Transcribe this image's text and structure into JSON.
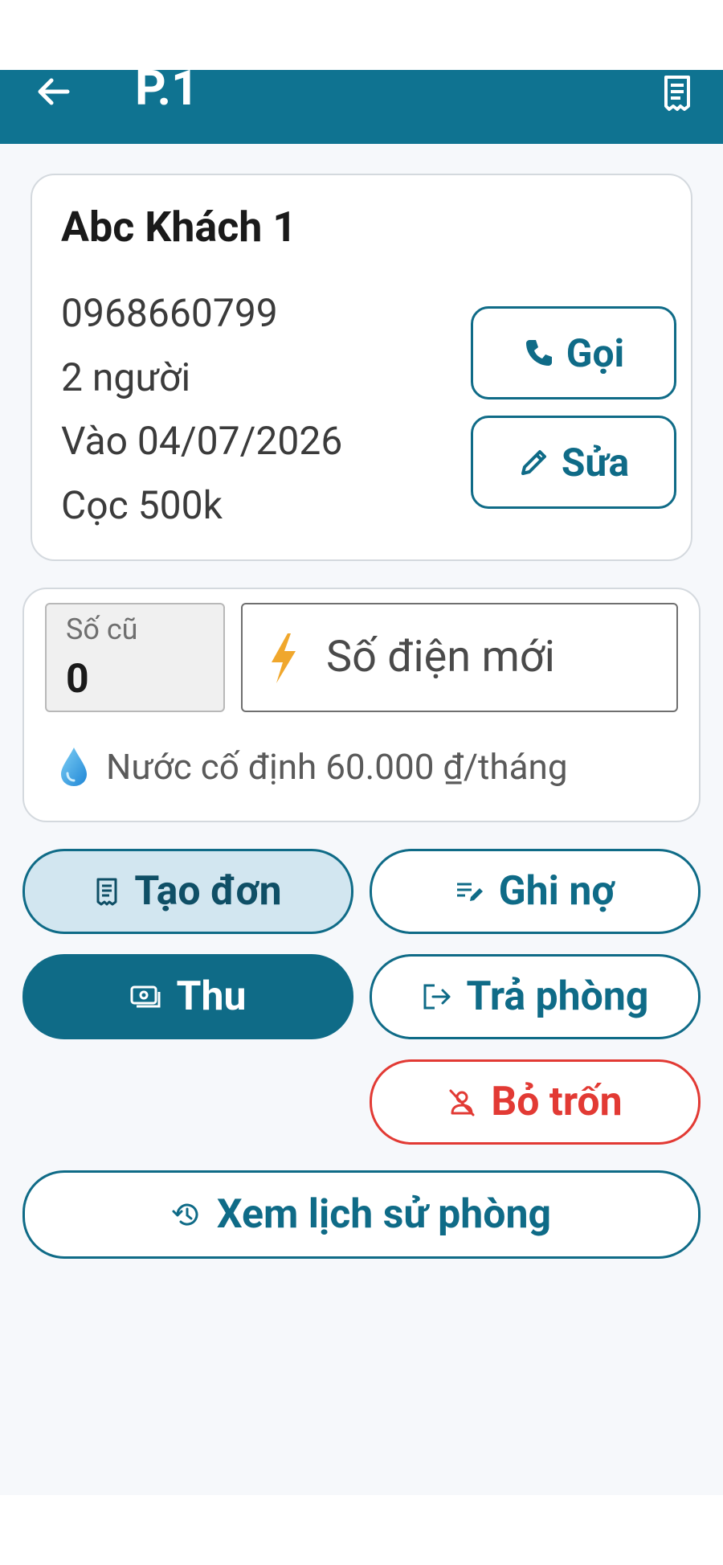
{
  "appbar": {
    "title": "P.1",
    "back_icon": "arrow-left-icon",
    "receipt_icon": "receipt-icon"
  },
  "tenant": {
    "name": "Abc Khách 1",
    "phone": "0968660799",
    "people": "2 người",
    "move_in": "Vào 04/07/2026",
    "deposit": "Cọc 500k",
    "call_label": "Gọi",
    "edit_label": "Sửa"
  },
  "meter": {
    "old_label": "Số cũ",
    "old_value": "0",
    "new_placeholder": "Số điện mới",
    "water_text": "Nước cố định 60.000 ₫/tháng"
  },
  "actions": {
    "create_invoice": "Tạo đơn",
    "record_debt": "Ghi nợ",
    "collect": "Thu",
    "checkout": "Trả phòng",
    "skip": "Bỏ trốn",
    "history": "Xem lịch sử phòng"
  },
  "colors": {
    "primary": "#0f7391",
    "primary_light": "#d2e6f0",
    "danger": "#e23a34",
    "background": "#f6f8fb"
  }
}
